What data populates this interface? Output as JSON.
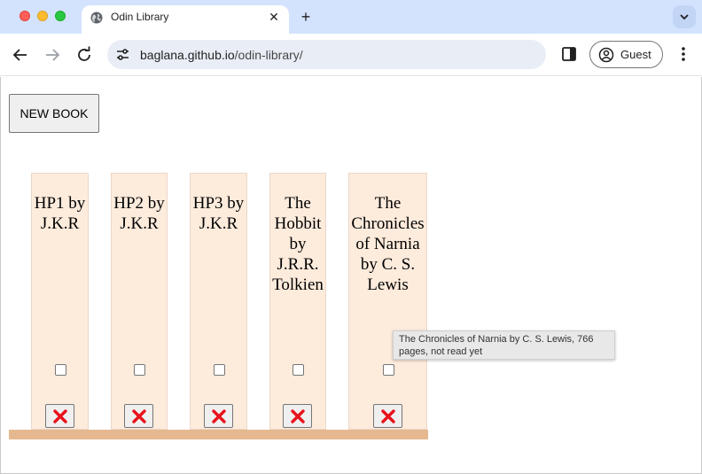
{
  "browser": {
    "tab_title": "Odin Library",
    "url_host": "baglana.github.io",
    "url_path": "/odin-library/",
    "profile_label": "Guest",
    "new_tab_symbol": "+",
    "close_symbol": "✕"
  },
  "page": {
    "new_book_label": "NEW BOOK",
    "books": [
      {
        "title": "HP1 by J.K.R",
        "read": false
      },
      {
        "title": "HP2 by J.K.R",
        "read": false
      },
      {
        "title": "HP3 by J.K.R",
        "read": false
      },
      {
        "title": "The Hobbit by J.R.R. Tolkien",
        "read": false
      },
      {
        "title": "The Chronicles of Narnia by C. S. Lewis",
        "read": false
      }
    ],
    "tooltip": "The Chronicles of Narnia by C. S. Lewis, 766 pages, not read yet"
  },
  "icons": {
    "remove": "red-x-icon",
    "favicon": "globe-icon"
  },
  "colors": {
    "book_bg": "#fdebdc",
    "shelf": "#e6b88f",
    "remove_x": "#e8111c",
    "tabbar": "#d3e3fd"
  }
}
